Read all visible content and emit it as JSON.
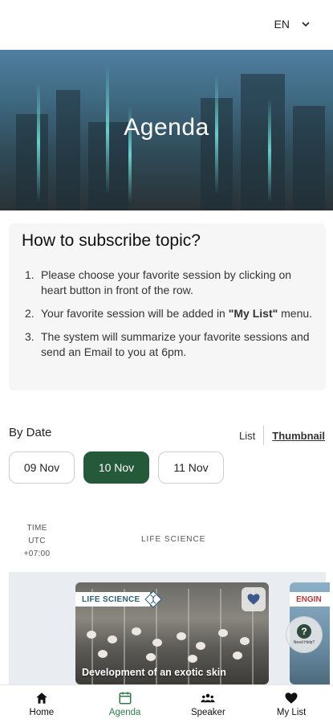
{
  "header": {
    "language": "EN"
  },
  "hero": {
    "title": "Agenda"
  },
  "info": {
    "title": "How to subscribe topic?",
    "steps": [
      {
        "num": "1.",
        "text": "Please choose your favorite session by clicking on heart button in front of the row."
      },
      {
        "num": "2.",
        "text_before": "Your favorite session will be added in ",
        "bold": "\"My List\"",
        "text_after": " menu."
      },
      {
        "num": "3.",
        "text": "The system will summarize your favorite sessions and send an Email to you at 6pm."
      }
    ]
  },
  "filter": {
    "by_date_label": "By Date",
    "view_list": "List",
    "view_thumbnail": "Thumbnail",
    "dates": [
      "09 Nov",
      "10 Nov",
      "11 Nov"
    ],
    "selected_date": "10 Nov"
  },
  "schedule": {
    "time_header": [
      "TIME",
      "UTC",
      "+07:00"
    ],
    "track_header": "LIFE SCIENCE",
    "sessions": [
      {
        "tag": "LIFE SCIENCE",
        "title": "Development of an exotic skin"
      },
      {
        "tag": "ENGIN"
      }
    ]
  },
  "help": {
    "label": "Need Help?"
  },
  "bottom_nav": {
    "items": [
      {
        "label": "Home",
        "icon": "home-icon"
      },
      {
        "label": "Agenda",
        "icon": "calendar-icon"
      },
      {
        "label": "Speaker",
        "icon": "people-icon"
      },
      {
        "label": "My List",
        "icon": "heart-icon"
      }
    ],
    "active": "Agenda"
  },
  "colors": {
    "accent_green": "#245a3a",
    "nav_active": "#2f7a49",
    "tag_blue": "#2b5f7c",
    "tag_red": "#c03a3a"
  }
}
